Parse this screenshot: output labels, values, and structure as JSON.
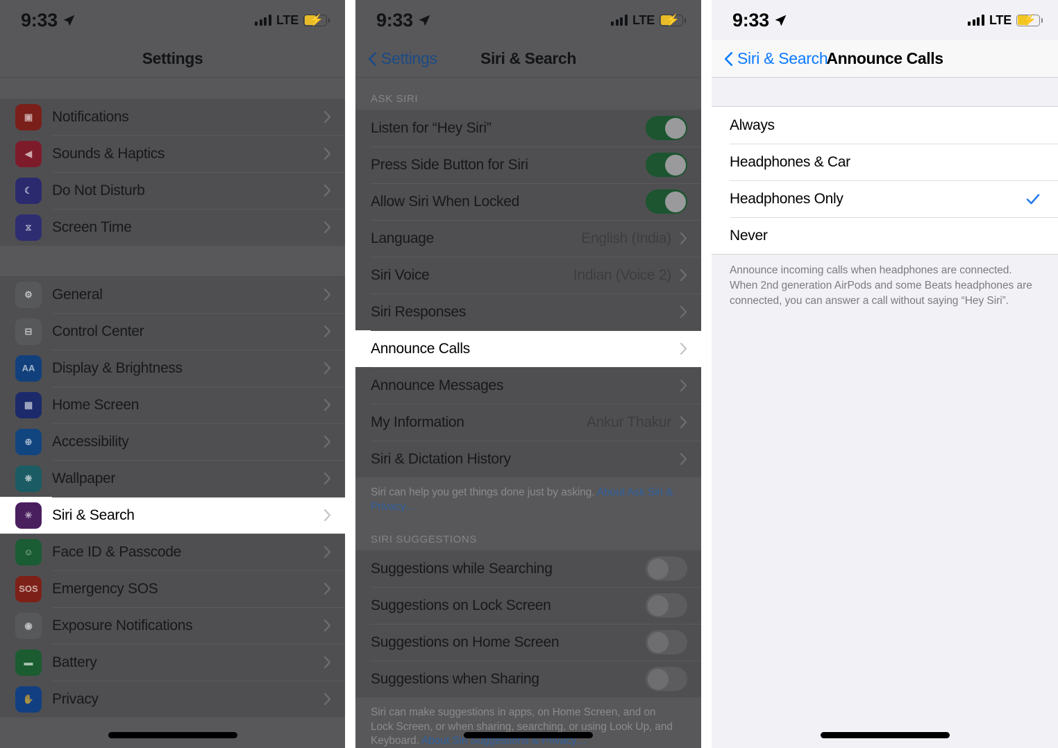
{
  "status_bar": {
    "time": "9:33",
    "location_icon": "location-arrow-icon",
    "signal_icon": "cellular-bars-icon",
    "network": "LTE",
    "battery_icon": "battery-charging-icon"
  },
  "panel1": {
    "nav": {
      "title": "Settings"
    },
    "groups": [
      {
        "rows": [
          {
            "label": "Notifications",
            "icon": "notifications-icon",
            "icon_glyph": "▣",
            "icon_color": "#7a1f1a",
            "accessory": "chevron"
          },
          {
            "label": "Sounds & Haptics",
            "icon": "sounds-haptics-icon",
            "icon_glyph": "◀",
            "icon_color": "#7e1b2b",
            "accessory": "chevron"
          },
          {
            "label": "Do Not Disturb",
            "icon": "do-not-disturb-icon",
            "icon_glyph": "☾",
            "icon_color": "#2b2a6e",
            "accessory": "chevron"
          },
          {
            "label": "Screen Time",
            "icon": "screen-time-icon",
            "icon_glyph": "⧖",
            "icon_color": "#2e2d72",
            "accessory": "chevron"
          }
        ]
      },
      {
        "rows": [
          {
            "label": "General",
            "icon": "general-gear-icon",
            "icon_glyph": "⚙",
            "icon_color": "#57585a",
            "accessory": "chevron"
          },
          {
            "label": "Control Center",
            "icon": "control-center-icon",
            "icon_glyph": "⊟",
            "icon_color": "#57585a",
            "accessory": "chevron"
          },
          {
            "label": "Display & Brightness",
            "icon": "display-brightness-icon",
            "icon_glyph": "AA",
            "icon_color": "#11407c",
            "accessory": "chevron"
          },
          {
            "label": "Home Screen",
            "icon": "home-screen-icon",
            "icon_glyph": "▦",
            "icon_color": "#1c2a6b",
            "accessory": "chevron"
          },
          {
            "label": "Accessibility",
            "icon": "accessibility-icon",
            "icon_glyph": "⊕",
            "icon_color": "#11457f",
            "accessory": "chevron"
          },
          {
            "label": "Wallpaper",
            "icon": "wallpaper-icon",
            "icon_glyph": "❋",
            "icon_color": "#1b5b63",
            "accessory": "chevron"
          },
          {
            "label": "Siri & Search",
            "icon": "siri-search-icon",
            "icon_glyph": "✳",
            "icon_color": "#4a1f5e",
            "accessory": "chevron",
            "highlighted": true
          },
          {
            "label": "Face ID & Passcode",
            "icon": "face-id-icon",
            "icon_glyph": "☺",
            "icon_color": "#1a5c34",
            "accessory": "chevron"
          },
          {
            "label": "Emergency SOS",
            "icon": "emergency-sos-icon",
            "icon_glyph": "SOS",
            "icon_color": "#7d2118",
            "accessory": "chevron"
          },
          {
            "label": "Exposure Notifications",
            "icon": "exposure-notifications-icon",
            "icon_glyph": "◉",
            "icon_color": "#57585a",
            "accessory": "chevron"
          },
          {
            "label": "Battery",
            "icon": "battery-icon",
            "icon_glyph": "▬",
            "icon_color": "#1b5c31",
            "accessory": "chevron"
          },
          {
            "label": "Privacy",
            "icon": "privacy-hand-icon",
            "icon_glyph": "✋",
            "icon_color": "#123f82",
            "accessory": "chevron"
          }
        ]
      }
    ]
  },
  "panel2": {
    "nav": {
      "back_label": "Settings",
      "title": "Siri & Search"
    },
    "section1_header": "ASK SIRI",
    "section1_rows": [
      {
        "label": "Listen for “Hey Siri”",
        "accessory": "toggle",
        "toggle_on": true
      },
      {
        "label": "Press Side Button for Siri",
        "accessory": "toggle",
        "toggle_on": true
      },
      {
        "label": "Allow Siri When Locked",
        "accessory": "toggle",
        "toggle_on": true
      },
      {
        "label": "Language",
        "accessory": "chevron",
        "value": "English (India)"
      },
      {
        "label": "Siri Voice",
        "accessory": "chevron",
        "value": "Indian (Voice 2)"
      },
      {
        "label": "Siri Responses",
        "accessory": "chevron",
        "value": ""
      },
      {
        "label": "Announce Calls",
        "accessory": "chevron",
        "value": "",
        "highlighted": true
      },
      {
        "label": "Announce Messages",
        "accessory": "chevron",
        "value": ""
      },
      {
        "label": "My Information",
        "accessory": "chevron",
        "value": "Ankur Thakur"
      },
      {
        "label": "Siri & Dictation History",
        "accessory": "chevron",
        "value": ""
      }
    ],
    "section1_footer_text": "Siri can help you get things done just by asking. ",
    "section1_footer_link": "About Ask Siri & Privacy…",
    "section2_header": "SIRI SUGGESTIONS",
    "section2_rows": [
      {
        "label": "Suggestions while Searching",
        "accessory": "toggle",
        "toggle_on": false
      },
      {
        "label": "Suggestions on Lock Screen",
        "accessory": "toggle",
        "toggle_on": false
      },
      {
        "label": "Suggestions on Home Screen",
        "accessory": "toggle",
        "toggle_on": false
      },
      {
        "label": "Suggestions when Sharing",
        "accessory": "toggle",
        "toggle_on": false
      }
    ],
    "section2_footer_text": "Siri can make suggestions in apps, on Home Screen, and on Lock Screen, or when sharing, searching, or using Look Up, and Keyboard. ",
    "section2_footer_link": "About Siri Suggestions & Privacy…"
  },
  "panel3": {
    "nav": {
      "back_label": "Siri & Search",
      "title": "Announce Calls"
    },
    "options": [
      {
        "label": "Always",
        "selected": false
      },
      {
        "label": "Headphones & Car",
        "selected": false
      },
      {
        "label": "Headphones Only",
        "selected": true
      },
      {
        "label": "Never",
        "selected": false
      }
    ],
    "footer": "Announce incoming calls when headphones are connected. When 2nd generation AirPods and some Beats headphones are connected, you can answer a call without saying “Hey Siri”.",
    "accent_color": "#2a7bef",
    "check_icon": "checkmark-icon"
  }
}
